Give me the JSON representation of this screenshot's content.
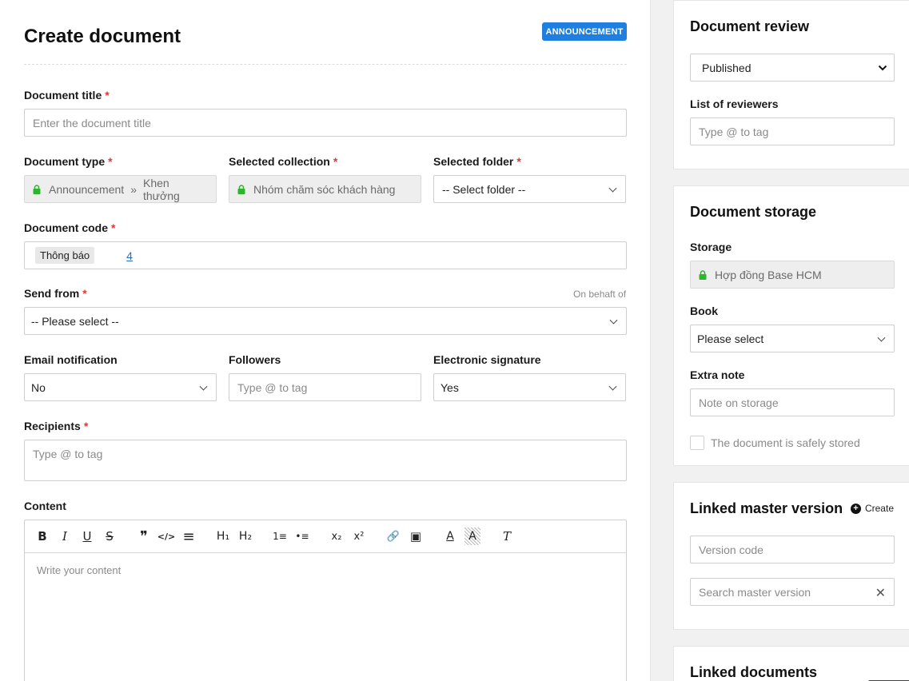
{
  "header": {
    "title": "Create document",
    "badge": "ANNOUNCEMENT"
  },
  "form": {
    "title_label": "Document title",
    "title_placeholder": "Enter the document title",
    "type_label": "Document type",
    "type_value_a": "Announcement",
    "type_sep": "»",
    "type_value_b": "Khen thưởng",
    "collection_label": "Selected collection",
    "collection_value": "Nhóm chăm sóc khách hàng",
    "folder_label": "Selected folder",
    "folder_value": "-- Select folder --",
    "code_label": "Document code",
    "code_tag": "Thông báo",
    "code_number": "4",
    "send_from_label": "Send from",
    "on_behalf_label": "On behaft of",
    "send_from_value": "-- Please select --",
    "email_label": "Email notification",
    "email_value": "No",
    "followers_label": "Followers",
    "followers_placeholder": "Type @ to tag",
    "esign_label": "Electronic signature",
    "esign_value": "Yes",
    "recipients_label": "Recipients",
    "recipients_placeholder": "Type @ to tag",
    "content_label": "Content",
    "content_placeholder": "Write your content",
    "required_mark": "*"
  },
  "toolbar": {
    "bold": "B",
    "italic": "I",
    "underline": "U",
    "strike": "S",
    "quote": "❞",
    "code": "</>",
    "align": "≡",
    "h1": "H₁",
    "h2": "H₂",
    "ordered_list": "1≡",
    "bullet_list": "•≡",
    "subscript": "x₂",
    "superscript": "x²",
    "link": "🔗",
    "image": "▣",
    "text_color": "A",
    "highlight": "A",
    "clear_format": "T"
  },
  "review": {
    "title": "Document review",
    "status_value": "Published",
    "status_options": [
      "Published"
    ],
    "reviewers_label": "List of reviewers",
    "reviewers_placeholder": "Type @ to tag"
  },
  "storage": {
    "title": "Document storage",
    "storage_label": "Storage",
    "storage_value": "Hợp đồng Base HCM",
    "book_label": "Book",
    "book_value": "Please select",
    "note_label": "Extra note",
    "note_placeholder": "Note on storage",
    "safe_label": "The document is safely stored"
  },
  "master": {
    "title": "Linked master version",
    "create_label": "Create",
    "version_placeholder": "Version code",
    "search_placeholder": "Search master version"
  },
  "linked": {
    "title": "Linked documents"
  },
  "colors": {
    "accent": "#1e7fe0",
    "required": "#d93a3a",
    "lock": "#2db52d"
  }
}
